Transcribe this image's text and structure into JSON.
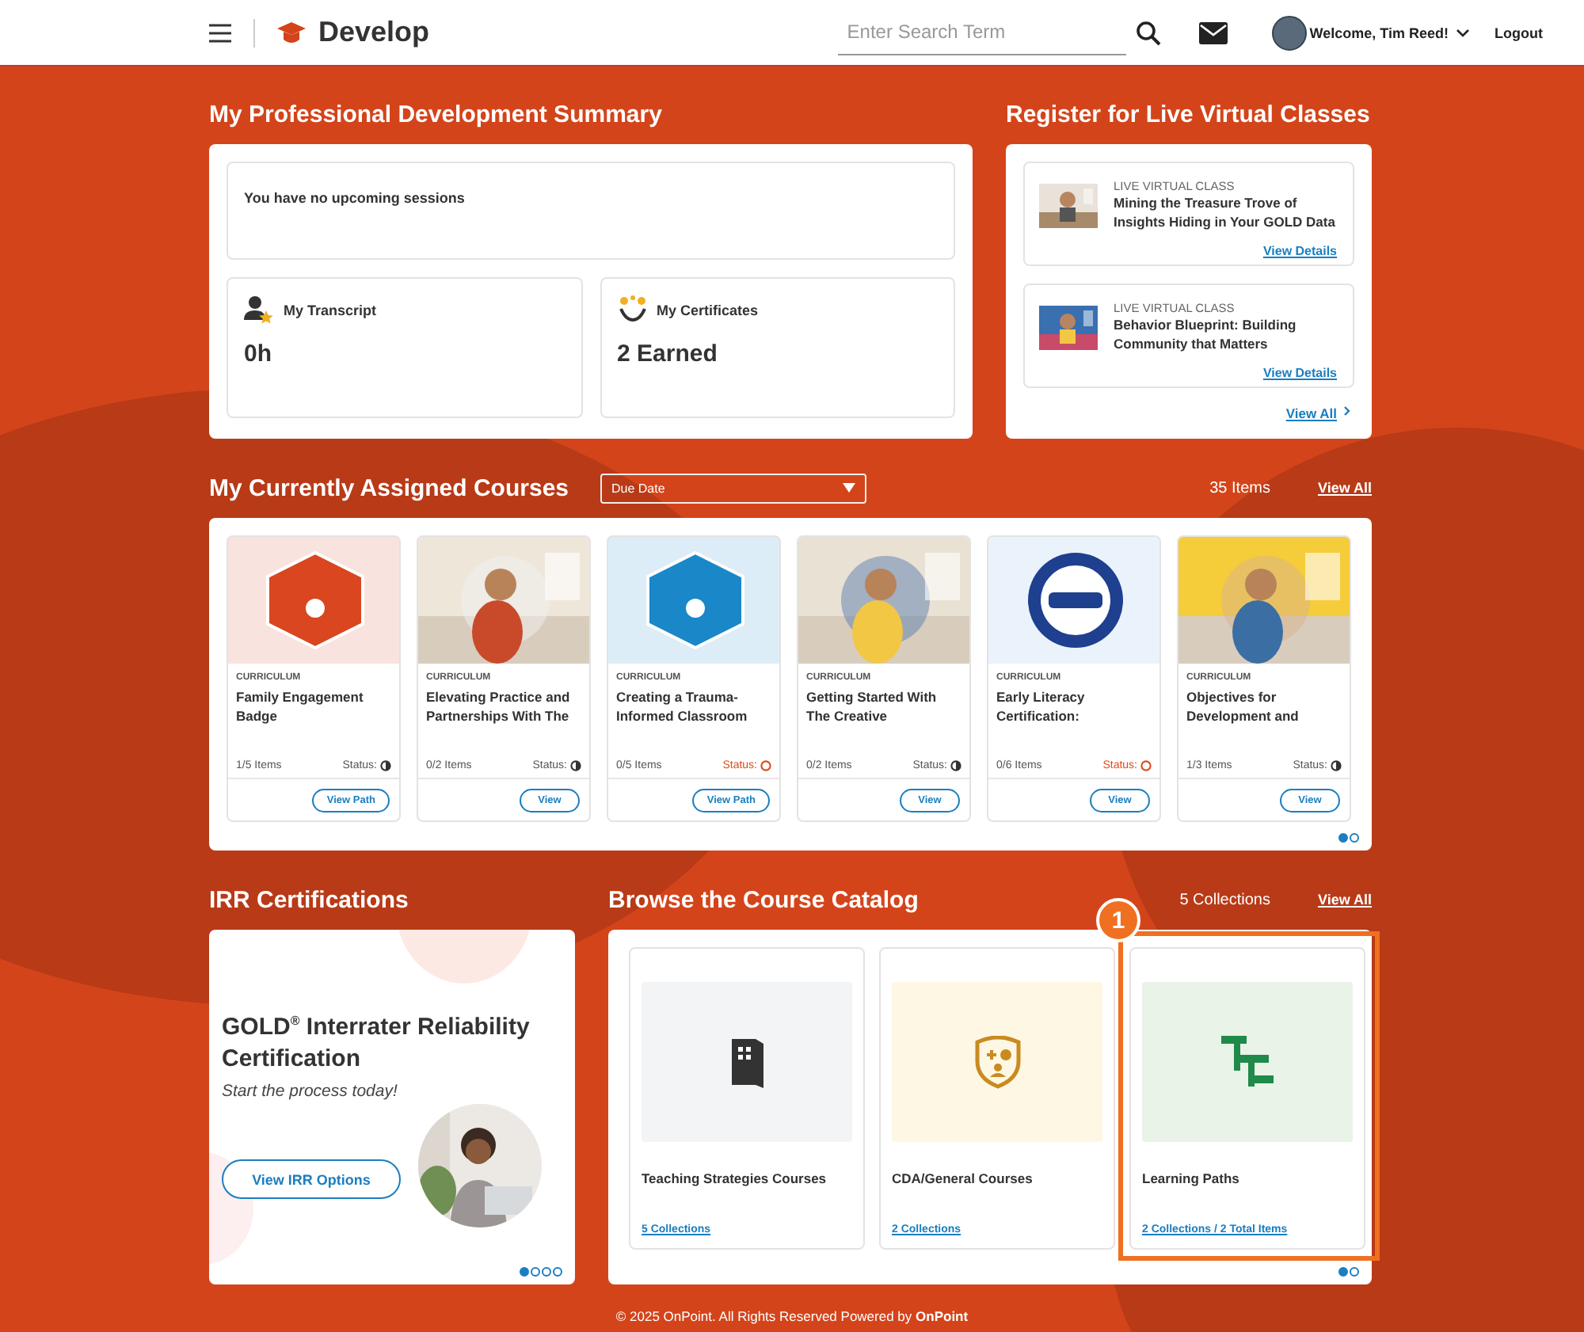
{
  "header": {
    "app_name": "Develop",
    "search": {
      "placeholder": "Enter Search Term"
    },
    "user": {
      "greeting": "Welcome, Tim Reed!"
    },
    "logout": "Logout"
  },
  "summary": {
    "title": "My Professional Development Summary",
    "sessions_text": "You have no upcoming sessions",
    "stats": [
      {
        "kind": "transcript",
        "label": "My Transcript",
        "value": "0h"
      },
      {
        "kind": "certificates",
        "label": "My Certificates",
        "value": "2 Earned"
      }
    ]
  },
  "live_classes": {
    "title": "Register for Live Virtual Classes",
    "items": [
      {
        "type": "LIVE VIRTUAL CLASS",
        "title": "Mining the Treasure Trove of Insights Hiding in Your GOLD Data",
        "link": "View Details"
      },
      {
        "type": "LIVE VIRTUAL CLASS",
        "title": "Behavior Blueprint: Building Community that Matters",
        "link": "View Details"
      }
    ],
    "view_all": "View All"
  },
  "assigned_courses": {
    "title": "My Currently Assigned Courses",
    "sort": {
      "value": "Due Date"
    },
    "count": "35 Items",
    "view_all": "View All",
    "courses": [
      {
        "image": {
          "kind": "badge",
          "color": "#d9461f"
        },
        "type": "CURRICULUM",
        "title": "Family Engagement Badge",
        "items": "1/5 Items",
        "status_label": "Status:",
        "started": true,
        "button": "View Path"
      },
      {
        "type": "CURRICULUM",
        "title": "Elevating Practice and Partnerships With The",
        "items": "0/2 Items",
        "status_label": "Status:",
        "started": true,
        "button": "View"
      },
      {
        "image": {
          "kind": "badge",
          "color": "#1a87c9"
        },
        "type": "CURRICULUM",
        "title": "Creating a Trauma-Informed Classroom",
        "items": "0/5 Items",
        "status_label": "Status:",
        "started": false,
        "button": "View Path"
      },
      {
        "type": "CURRICULUM",
        "title": "Getting Started With The Creative",
        "items": "0/2 Items",
        "status_label": "Status:",
        "started": true,
        "button": "View"
      },
      {
        "image": {
          "kind": "seal",
          "color": "#1f3f8f"
        },
        "type": "CURRICULUM",
        "title": "Early Literacy Certification:",
        "items": "0/6 Items",
        "status_label": "Status:",
        "started": false,
        "button": "View"
      },
      {
        "type": "CURRICULUM",
        "title": "Objectives for Development and",
        "items": "1/3 Items",
        "status_label": "Status:",
        "started": true,
        "button": "View"
      }
    ],
    "pages": [
      {
        "selected": true
      },
      {
        "selected": false
      }
    ]
  },
  "irr": {
    "title": "IRR Certifications",
    "heading": "GOLD$^{®}$ Interrater Reliability Certification",
    "subtitle": "Start the process today!",
    "button": "View IRR Options",
    "pages": [
      {
        "selected": true
      },
      {
        "selected": false
      },
      {
        "selected": false
      },
      {
        "selected": false
      }
    ]
  },
  "catalog": {
    "title": "Browse the Course Catalog",
    "count": "5 Collections",
    "view_all": "View All",
    "collections": [
      {
        "kind": "book",
        "title": "Teaching Strategies Courses",
        "link": "5 Collections",
        "highlighted": false
      },
      {
        "kind": "shield",
        "title": "CDA/General Courses",
        "link": "2 Collections",
        "highlighted": false
      },
      {
        "kind": "path",
        "title": "Learning Paths",
        "link": "2 Collections / 2 Total Items",
        "highlighted": true,
        "callout": "1"
      }
    ],
    "pages": [
      {
        "selected": true
      },
      {
        "selected": false
      }
    ]
  },
  "footer": "© 2025 OnPoint. All Rights Reserved Powered by **OnPoint**"
}
